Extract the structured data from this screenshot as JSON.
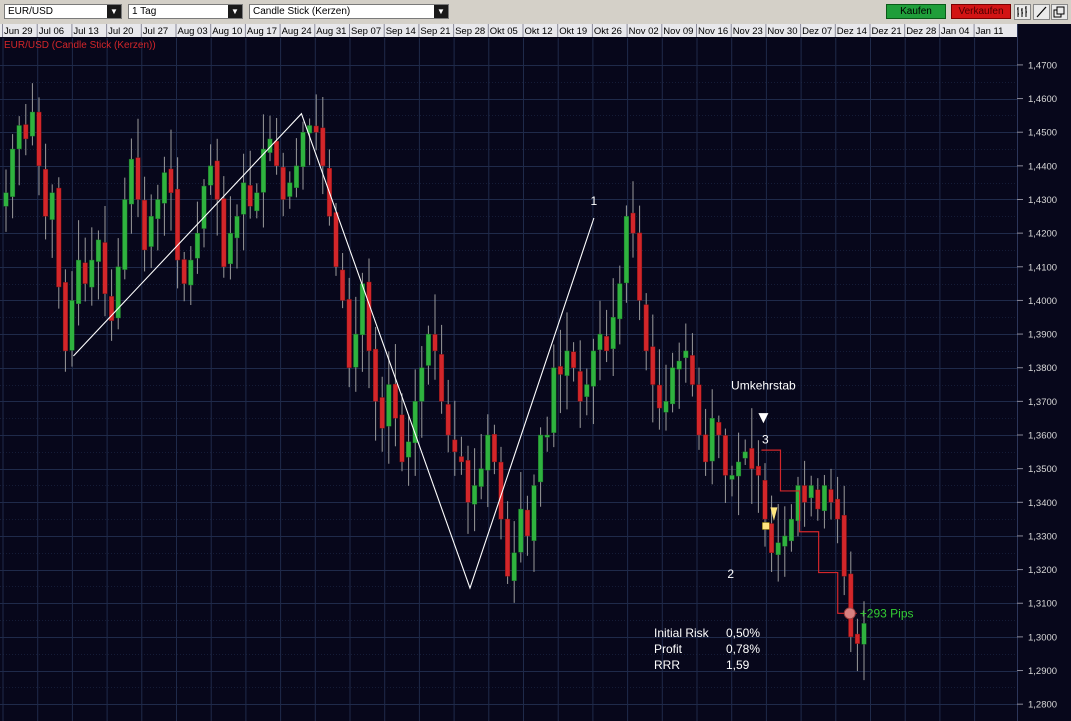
{
  "toolbar": {
    "symbol": "EUR/USD",
    "interval": "1 Tag",
    "chart_style": "Candle Stick (Kerzen)",
    "buy_label": "Kaufen",
    "sell_label": "Verkaufen",
    "tool_icons": [
      "bars-icon",
      "draw-line-icon",
      "detach-window-icon"
    ]
  },
  "colors": {
    "background": "#07071b",
    "grid": "#1f2a4a",
    "bull": "#2fb33f",
    "bear": "#d3262a",
    "wick": "#9a9a9a",
    "stop": "#d3262a",
    "profit_text": "#33cc33",
    "title_text": "#d3262a"
  },
  "chart_data": {
    "type": "candlestick",
    "title": "EUR/USD (Candle Stick (Kerzen))",
    "x_tick_labels": [
      "Jun 29",
      "Jul 06",
      "Jul 13",
      "Jul 20",
      "Jul 27",
      "Aug 03",
      "Aug 10",
      "Aug 17",
      "Aug 24",
      "Aug 31",
      "Sep 07",
      "Sep 14",
      "Sep 21",
      "Sep 28",
      "Okt 05",
      "Okt 12",
      "Okt 19",
      "Okt 26",
      "Nov 02",
      "Nov 09",
      "Nov 16",
      "Nov 23",
      "Nov 30",
      "Dez 07",
      "Dez 14",
      "Dez 21",
      "Dez 28",
      "Jan 04",
      "Jan 11"
    ],
    "y_tick_labels": [
      "1,4700",
      "1,4600",
      "1,4500",
      "1,4400",
      "1,4300",
      "1,4200",
      "1,4100",
      "1,4000",
      "1,3900",
      "1,3800",
      "1,3700",
      "1,3600",
      "1,3500",
      "1,3400",
      "1,3300",
      "1,3200",
      "1,3100",
      "1,3000",
      "1,2900",
      "1,2800"
    ],
    "ylim": [
      1.275,
      1.478
    ],
    "candle_closes": [
      1.432,
      1.445,
      1.452,
      1.448,
      1.456,
      1.44,
      1.425,
      1.432,
      1.404,
      1.385,
      1.4,
      1.412,
      1.405,
      1.412,
      1.418,
      1.402,
      1.394,
      1.41,
      1.43,
      1.442,
      1.43,
      1.415,
      1.425,
      1.43,
      1.438,
      1.432,
      1.412,
      1.405,
      1.412,
      1.42,
      1.434,
      1.44,
      1.43,
      1.41,
      1.42,
      1.425,
      1.435,
      1.428,
      1.432,
      1.445,
      1.448,
      1.44,
      1.43,
      1.435,
      1.44,
      1.45,
      1.452,
      1.45,
      1.44,
      1.425,
      1.41,
      1.4,
      1.38,
      1.39,
      1.405,
      1.385,
      1.37,
      1.362,
      1.375,
      1.365,
      1.352,
      1.358,
      1.37,
      1.38,
      1.39,
      1.385,
      1.37,
      1.36,
      1.355,
      1.352,
      1.34,
      1.345,
      1.35,
      1.36,
      1.352,
      1.335,
      1.318,
      1.325,
      1.338,
      1.33,
      1.345,
      1.36,
      1.36,
      1.38,
      1.378,
      1.385,
      1.38,
      1.37,
      1.375,
      1.385,
      1.39,
      1.385,
      1.395,
      1.405,
      1.425,
      1.42,
      1.4,
      1.385,
      1.375,
      1.368,
      1.37,
      1.38,
      1.382,
      1.385,
      1.375,
      1.36,
      1.352,
      1.365,
      1.36,
      1.348,
      1.348,
      1.352,
      1.355,
      1.35,
      1.348,
      1.335,
      1.325,
      1.328,
      1.33,
      1.335,
      1.345,
      1.34,
      1.345,
      1.338,
      1.345,
      1.34,
      1.335,
      1.318,
      1.3,
      1.298,
      1.304
    ],
    "pattern_points": [
      {
        "x_label": "Jul 13",
        "y": 1.3835
      },
      {
        "x_label": "Aug 28",
        "y": 1.4555
      },
      {
        "x_label": "Okt 01",
        "y": 1.3145
      },
      {
        "x_label": "Okt 26",
        "y": 1.4245
      }
    ],
    "stop_level_start": 1.3555,
    "stop_level_end": 1.307,
    "labels": [
      {
        "text": "1",
        "role": "peak-1"
      },
      {
        "text": "2",
        "role": "low-2"
      },
      {
        "text": "3",
        "role": "high-3"
      },
      {
        "text": "Umkehrstab",
        "role": "reversal-bar"
      },
      {
        "text": "+293 Pips",
        "role": "profit"
      }
    ],
    "stats": [
      {
        "label": "Initial Risk",
        "value": "0,50%"
      },
      {
        "label": "Profit",
        "value": "0,78%"
      },
      {
        "label": "RRR",
        "value": "1,59"
      }
    ]
  }
}
